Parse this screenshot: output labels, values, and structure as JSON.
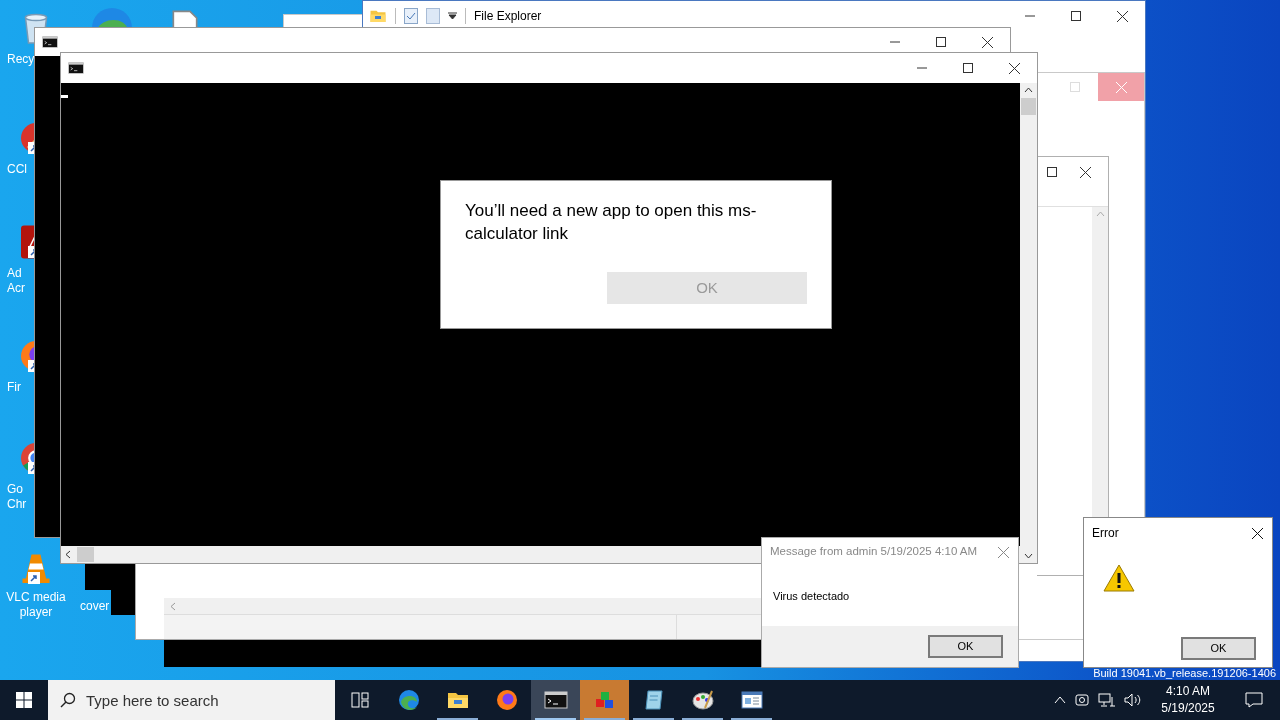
{
  "desktop": {
    "icons": [
      {
        "kind": "recycle",
        "lines": [
          "Recy"
        ]
      },
      {
        "kind": "ccleaner",
        "lines": [
          "CCl"
        ]
      },
      {
        "kind": "acrobat",
        "lines": [
          "Ad",
          "Acr"
        ]
      },
      {
        "kind": "firefox",
        "lines": [
          "Fir"
        ]
      },
      {
        "kind": "chrome",
        "lines": [
          "Go",
          "Chr"
        ]
      },
      {
        "kind": "vlc",
        "lines": [
          "VLC media",
          "player"
        ]
      },
      {
        "lines": [
          "cover"
        ]
      }
    ],
    "build_label": "Build 19041.vb_release.191206-1406"
  },
  "file_explorer": {
    "title": "File Explorer"
  },
  "app_dialog": {
    "message": "You’ll need a new app to open this ms-calculator link",
    "button": "OK",
    "button_disabled": true
  },
  "message_dialog": {
    "title": "Message from admin 5/19/2025 4:10 AM",
    "body": "Virus detectado",
    "button": "OK"
  },
  "error_dialog": {
    "title": "Error",
    "button": "OK"
  },
  "taskbar": {
    "search_placeholder": "Type here to search",
    "apps": [
      {
        "kind": "task-view",
        "selected": false,
        "attention": false,
        "running": false
      },
      {
        "kind": "edge",
        "selected": false,
        "attention": false,
        "running": false
      },
      {
        "kind": "folder",
        "selected": false,
        "attention": false,
        "running": true
      },
      {
        "kind": "firefox",
        "selected": false,
        "attention": false,
        "running": false
      },
      {
        "kind": "console",
        "selected": true,
        "attention": false,
        "running": true
      },
      {
        "kind": "cubes",
        "selected": false,
        "attention": true,
        "running": true
      },
      {
        "kind": "notebook",
        "selected": false,
        "attention": false,
        "running": true
      },
      {
        "kind": "palette",
        "selected": false,
        "attention": false,
        "running": true
      },
      {
        "kind": "window",
        "selected": false,
        "attention": false,
        "running": true
      }
    ],
    "time": "4:10 AM",
    "date": "5/19/2025"
  }
}
